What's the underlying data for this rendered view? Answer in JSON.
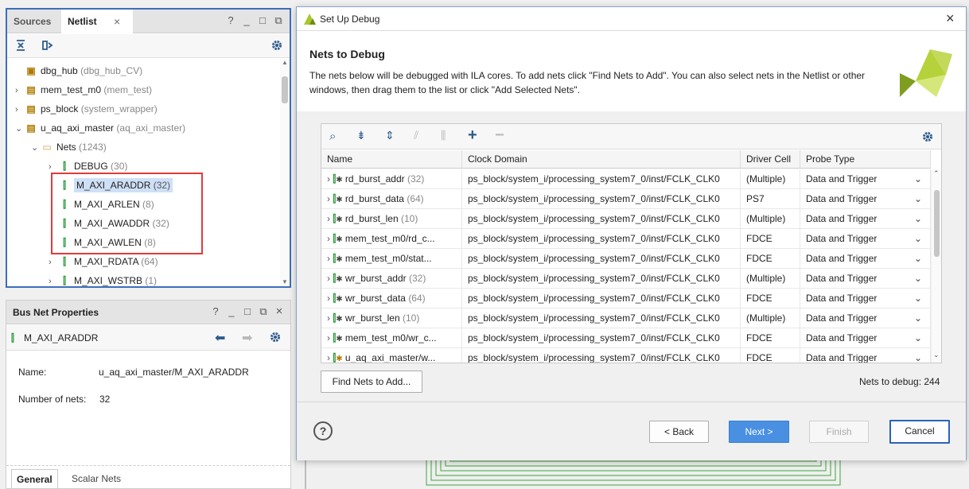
{
  "netlist_panel": {
    "tabs": [
      "Sources",
      "Netlist"
    ],
    "tab_close": "×",
    "window_controls": [
      "?",
      "_",
      "□",
      "⧉"
    ],
    "toolbar_icons": [
      "collapse-all-icon",
      "expand-all-icon",
      "gear-icon"
    ],
    "tree": [
      {
        "name": "dbg_hub",
        "detail": "(dbg_hub_CV)",
        "icon": "chip-icon",
        "expandable": false
      },
      {
        "name": "mem_test_m0",
        "detail": "(mem_test)",
        "icon": "module-icon",
        "expandable": true
      },
      {
        "name": "ps_block",
        "detail": "(system_wrapper)",
        "icon": "module-icon",
        "expandable": true
      },
      {
        "name": "u_aq_axi_master",
        "detail": "(aq_axi_master)",
        "icon": "module-icon",
        "expandable": true,
        "expanded": true
      },
      {
        "name": "Nets",
        "detail": "(1243)",
        "icon": "folder-icon",
        "expandable": true,
        "expanded": true
      },
      {
        "name": "DEBUG",
        "detail": "(30)",
        "icon": "net-icon",
        "expandable": true
      },
      {
        "name": "M_AXI_ARADDR",
        "detail": "(32)",
        "icon": "net-icon",
        "selected": true
      },
      {
        "name": "M_AXI_ARLEN",
        "detail": "(8)",
        "icon": "net-icon"
      },
      {
        "name": "M_AXI_AWADDR",
        "detail": "(32)",
        "icon": "net-icon"
      },
      {
        "name": "M_AXI_AWLEN",
        "detail": "(8)",
        "icon": "net-icon"
      },
      {
        "name": "M_AXI_RDATA",
        "detail": "(64)",
        "icon": "net-icon",
        "expandable": true
      },
      {
        "name": "M_AXI_WSTRB",
        "detail": "(1)",
        "icon": "net-icon",
        "expandable": true
      }
    ],
    "highlight_color": "#e23a3a",
    "border_color": "#3d6fb8"
  },
  "bus_props": {
    "title": "Bus Net Properties",
    "window_controls": [
      "?",
      "_",
      "□",
      "⧉",
      "×"
    ],
    "selected_net": "M_AXI_ARADDR",
    "fields": [
      {
        "label": "Name:",
        "value": "u_aq_axi_master/M_AXI_ARADDR"
      },
      {
        "label": "Number of nets:",
        "value": "32"
      }
    ],
    "tabs": [
      "General",
      "Scalar Nets"
    ]
  },
  "dialog": {
    "title": "Set Up Debug",
    "close": "×",
    "heading": "Nets to Debug",
    "description_line1": "The nets below will be debugged with ILA cores. To add nets click \"Find Nets to Add\". You can also select nets in the Netlist or other",
    "description_line2": "windows, then drag them to the list or click \"Add Selected Nets\".",
    "table_toolbar_icons": [
      "search-icon",
      "collapse-icon",
      "expand-icon",
      "split-icon",
      "bus-icon",
      "add-icon",
      "remove-icon",
      "gear-icon"
    ],
    "columns": [
      "Name",
      "Clock Domain",
      "Driver Cell",
      "Probe Type"
    ],
    "rows": [
      {
        "name": "rd_burst_addr",
        "width": "(32)",
        "clock": "ps_block/system_i/processing_system7_0/inst/FCLK_CLK0",
        "driver": "(Multiple)",
        "probe": "Data and Trigger"
      },
      {
        "name": "rd_burst_data",
        "width": "(64)",
        "clock": "ps_block/system_i/processing_system7_0/inst/FCLK_CLK0",
        "driver": "PS7",
        "probe": "Data and Trigger"
      },
      {
        "name": "rd_burst_len",
        "width": "(10)",
        "clock": "ps_block/system_i/processing_system7_0/inst/FCLK_CLK0",
        "driver": "(Multiple)",
        "probe": "Data and Trigger"
      },
      {
        "name": "mem_test_m0/rd_c...",
        "width": "",
        "clock": "ps_block/system_i/processing_system7_0/inst/FCLK_CLK0",
        "driver": "FDCE",
        "probe": "Data and Trigger"
      },
      {
        "name": "mem_test_m0/stat...",
        "width": "",
        "clock": "ps_block/system_i/processing_system7_0/inst/FCLK_CLK0",
        "driver": "FDCE",
        "probe": "Data and Trigger"
      },
      {
        "name": "wr_burst_addr",
        "width": "(32)",
        "clock": "ps_block/system_i/processing_system7_0/inst/FCLK_CLK0",
        "driver": "(Multiple)",
        "probe": "Data and Trigger"
      },
      {
        "name": "wr_burst_data",
        "width": "(64)",
        "clock": "ps_block/system_i/processing_system7_0/inst/FCLK_CLK0",
        "driver": "FDCE",
        "probe": "Data and Trigger"
      },
      {
        "name": "wr_burst_len",
        "width": "(10)",
        "clock": "ps_block/system_i/processing_system7_0/inst/FCLK_CLK0",
        "driver": "(Multiple)",
        "probe": "Data and Trigger"
      },
      {
        "name": "mem_test_m0/wr_c...",
        "width": "",
        "clock": "ps_block/system_i/processing_system7_0/inst/FCLK_CLK0",
        "driver": "FDCE",
        "probe": "Data and Trigger"
      },
      {
        "name": "u_aq_axi_master/w...",
        "width": "",
        "clock": "ps_block/system_i/processing_system7_0/inst/FCLK_CLK0",
        "driver": "FDCE",
        "probe": "Data and Trigger"
      }
    ],
    "find_button": "Find Nets to Add...",
    "nets_count": "Nets to debug: 244",
    "help": "?",
    "back_button": "< Back",
    "next_button": "Next >",
    "finish_button": "Finish",
    "cancel_button": "Cancel",
    "accent_color": "#4a90e2",
    "logo_color": "#a7c72b"
  }
}
